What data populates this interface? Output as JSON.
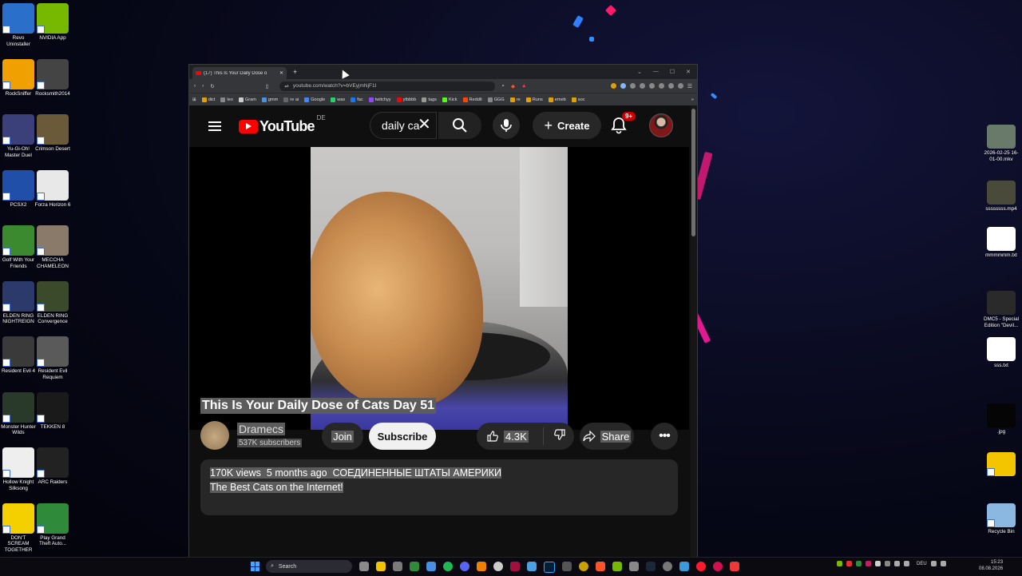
{
  "desktop_left": [
    {
      "label": "Revo Uninstaller",
      "icon": "revo-uninstaller-icon",
      "color": "#2a6fc9"
    },
    {
      "label": "NVIDIA App",
      "icon": "nvidia-icon",
      "color": "#76b900"
    },
    {
      "label": "RockSniffer",
      "icon": "rocksniffer-icon",
      "color": "#f0a000"
    },
    {
      "label": "Rocksmith2014",
      "icon": "rocksmith-icon",
      "color": "#444444"
    },
    {
      "label": "Yu-Gi-Oh! Master Duel",
      "icon": "yugioh-icon",
      "color": "#3b3f7a"
    },
    {
      "label": "Crimson Desert",
      "icon": "crimson-desert-icon",
      "color": "#6b5a3a"
    },
    {
      "label": "PCSX2",
      "icon": "pcsx2-icon",
      "color": "#1f4fa8"
    },
    {
      "label": "Forza Horizon 6",
      "icon": "forza-icon",
      "color": "#e8e8e8"
    },
    {
      "label": "Golf With Your Friends",
      "icon": "golf-icon",
      "color": "#3b8a2f"
    },
    {
      "label": "MECCHA CHAMELEON",
      "icon": "chameleon-icon",
      "color": "#8a7a6a"
    },
    {
      "label": "ELDEN RING NIGHTREIGN",
      "icon": "nightreign-icon",
      "color": "#2b3a6a"
    },
    {
      "label": "ELDEN RING Convergence",
      "icon": "elden-ring-icon",
      "color": "#3a4a2a"
    },
    {
      "label": "Resident Evil 4",
      "icon": "re4-icon",
      "color": "#3a3a3a"
    },
    {
      "label": "Resident Evil Requiem",
      "icon": "re-requiem-icon",
      "color": "#5a5a5a"
    },
    {
      "label": "Monster Hunter Wilds",
      "icon": "mhwilds-icon",
      "color": "#2a3a2a"
    },
    {
      "label": "TEKKEN 8",
      "icon": "tekken-icon",
      "color": "#1a1a1a"
    },
    {
      "label": "Hollow Knight Silksong",
      "icon": "silksong-icon",
      "color": "#eeeeee"
    },
    {
      "label": "ARC Raiders",
      "icon": "arc-raiders-icon",
      "color": "#222222"
    },
    {
      "label": "DON'T SCREAM TOGETHER",
      "icon": "dont-scream-icon",
      "color": "#f5d000"
    },
    {
      "label": "Play Grand Theft Auto...",
      "icon": "gta-icon",
      "color": "#2f8a3a"
    }
  ],
  "desktop_right": [
    {
      "label": "2026-02-25 16-01-00.mkv",
      "icon": "video-file-icon",
      "color": "#6a7a6a"
    },
    {
      "label": "ssssssss.mp4",
      "icon": "video-file-icon",
      "color": "#4a4a3a"
    },
    {
      "label": "mmmmmm.txt",
      "icon": "text-file-icon",
      "color": "#ffffff"
    },
    {
      "label": "DMC5 - Special Edition \"Devil...",
      "icon": "video-file-icon",
      "color": "#2a2a2a"
    },
    {
      "label": "sss.txt",
      "icon": "text-file-icon",
      "color": "#ffffff"
    },
    {
      "label": ".jpg",
      "icon": "image-file-icon",
      "color": "#050505"
    },
    {
      "label": "",
      "icon": "folder-icon",
      "color": "#f2c500"
    },
    {
      "label": "Recycle Bin",
      "icon": "recycle-bin-icon",
      "color": "#8ab8e0"
    }
  ],
  "browser": {
    "tab_title": "(17) This Is Your Daily Dose o",
    "url": "youtube.com/watch?v=bVEyjmNjF1I",
    "bookmarks": [
      {
        "label": "dict",
        "color": "#e0a000"
      },
      {
        "label": "leo",
        "color": "#888888"
      },
      {
        "label": "Gram",
        "color": "#cccccc"
      },
      {
        "label": "gmm",
        "color": "#4a90e2"
      },
      {
        "label": "re ai",
        "color": "#666666"
      },
      {
        "label": "Google",
        "color": "#4285f4"
      },
      {
        "label": "was",
        "color": "#25d366"
      },
      {
        "label": "fac",
        "color": "#1877f2"
      },
      {
        "label": "twitchyy",
        "color": "#9146ff"
      },
      {
        "label": "ytbbbb",
        "color": "#ff0000"
      },
      {
        "label": "tags",
        "color": "#999999"
      },
      {
        "label": "Kick",
        "color": "#53fc18"
      },
      {
        "label": "Reddit",
        "color": "#ff4500"
      },
      {
        "label": "GGG",
        "color": "#888888"
      },
      {
        "label": "re",
        "color": "#e0a000"
      },
      {
        "label": "Runs",
        "color": "#e0a000"
      },
      {
        "label": "emeb",
        "color": "#e0a000"
      },
      {
        "label": "soc",
        "color": "#e0a000"
      }
    ]
  },
  "youtube": {
    "logo_text": "YouTube",
    "country": "DE",
    "search_value": "daily ca",
    "create_label": "Create",
    "notif_badge": "9+",
    "video_title": "This Is Your Daily Dose of Cats Day 51",
    "channel_name": "Dramecs",
    "subscribers": "537K subscribers",
    "join_label": "Join",
    "subscribe_label": "Subscribe",
    "likes": "4.3K",
    "share_label": "Share",
    "views": "170K views",
    "date": "5 months ago",
    "location": "СОЕДИНЕННЫЕ ШТАТЫ АМЕРИКИ",
    "description": "The Best Cats on the Internet!"
  },
  "taskbar": {
    "search_placeholder": "Search",
    "language": "DEU",
    "time": "15:23",
    "date": "08.08.2026"
  }
}
